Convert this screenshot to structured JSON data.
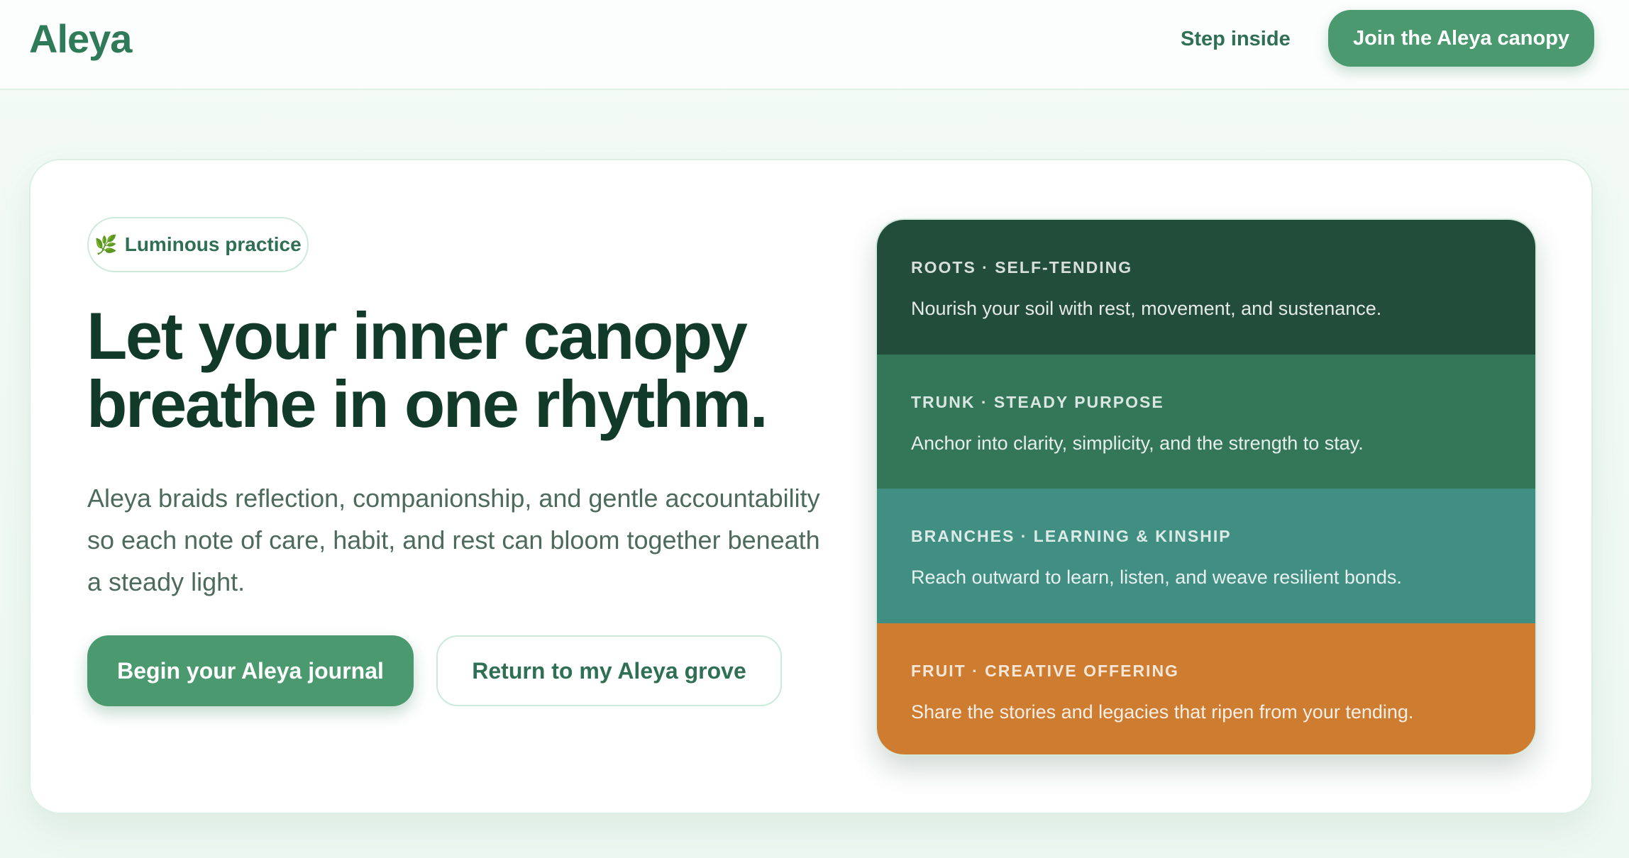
{
  "header": {
    "logo": "Aleya",
    "nav_link": "Step inside",
    "cta": "Join the Aleya canopy"
  },
  "hero": {
    "badge_icon": "leaf-icon",
    "badge": "Luminous practice",
    "headline": "Let your inner canopy breathe in one rhythm.",
    "lede": "Aleya braids reflection, companionship, and gentle accountability so each note of care, habit, and rest can bloom together beneath a steady light.",
    "primary_button": "Begin your Aleya journal",
    "secondary_button": "Return to my Aleya grove"
  },
  "tiers": [
    {
      "title": "ROOTS · SELF-TENDING",
      "desc": "Nourish your soil with rest, movement, and sustenance.",
      "color": "#234d3b"
    },
    {
      "title": "TRUNK · STEADY PURPOSE",
      "desc": "Anchor into clarity, simplicity, and the strength to stay.",
      "color": "#347658"
    },
    {
      "title": "BRANCHES · LEARNING & KINSHIP",
      "desc": "Reach outward to learn, listen, and weave resilient bonds.",
      "color": "#418f82"
    },
    {
      "title": "FRUIT · CREATIVE OFFERING",
      "desc": "Share the stories and legacies that ripen from your tending.",
      "color": "#ce7c30"
    }
  ],
  "colors": {
    "accent": "#4b9a6f",
    "brand_text": "#2f7a58",
    "headline": "#123a2a"
  }
}
